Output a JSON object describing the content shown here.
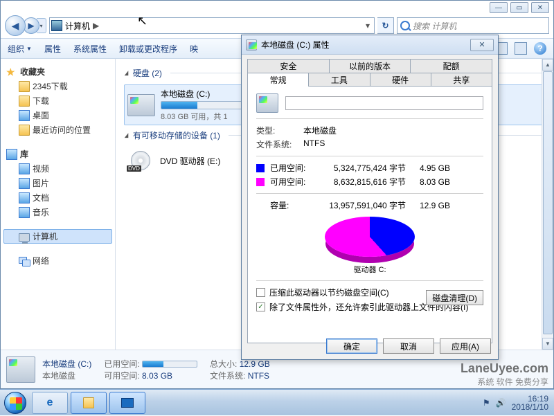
{
  "window": {
    "address_path": "计算机",
    "address_sep": "▶",
    "search_placeholder": "搜索 计算机"
  },
  "toolbar": {
    "organize": "组织",
    "properties": "属性",
    "sysprops": "系统属性",
    "uninstall": "卸载或更改程序",
    "map": "映"
  },
  "sidebar": {
    "favorites": "收藏夹",
    "fav_items": [
      "2345下载",
      "下载",
      "桌面",
      "最近访问的位置"
    ],
    "libraries": "库",
    "lib_items": [
      "视频",
      "图片",
      "文档",
      "音乐"
    ],
    "computer": "计算机",
    "network": "网络"
  },
  "content": {
    "section_hdd": "硬盘 (2)",
    "section_removable": "有可移动存储的设备 (1)",
    "drive_c_name": "本地磁盘 (C:)",
    "drive_c_sub": "8.03 GB 可用，共 1",
    "dvd_name": "DVD 驱动器 (E:)"
  },
  "details": {
    "name": "本地磁盘 (C:)",
    "type": "本地磁盘",
    "used_label": "已用空间:",
    "free_label": "可用空间:",
    "free_value": "8.03 GB",
    "total_label": "总大小:",
    "total_value": "12.9 GB",
    "fs_label": "文件系统:",
    "fs_value": "NTFS"
  },
  "dialog": {
    "title": "本地磁盘 (C:) 属性",
    "tabs_top": [
      "安全",
      "以前的版本",
      "配额"
    ],
    "tabs_bottom": [
      "常规",
      "工具",
      "硬件",
      "共享"
    ],
    "type_label": "类型:",
    "type_value": "本地磁盘",
    "fs_label": "文件系统:",
    "fs_value": "NTFS",
    "used_label": "已用空间:",
    "used_bytes": "5,324,775,424 字节",
    "used_gb": "4.95 GB",
    "free_label": "可用空间:",
    "free_bytes": "8,632,815,616 字节",
    "free_gb": "8.03 GB",
    "cap_label": "容量:",
    "cap_bytes": "13,957,591,040 字节",
    "cap_gb": "12.9 GB",
    "drive_label": "驱动器 C:",
    "cleanup": "磁盘清理(D)",
    "compress": "压缩此驱动器以节约磁盘空间(C)",
    "index": "除了文件属性外，还允许索引此驱动器上文件的内容(I)",
    "ok": "确定",
    "cancel": "取消",
    "apply": "应用(A)"
  },
  "taskbar": {
    "time": "16:19",
    "date": "2018/1/10"
  },
  "watermark": {
    "line1": "LaneUyee.com",
    "line2": "系统 软件 免费分享"
  },
  "chart_data": {
    "type": "pie",
    "title": "驱动器 C:",
    "series": [
      {
        "name": "已用空间",
        "value": 4.95,
        "bytes": 5324775424,
        "color": "#0000ff"
      },
      {
        "name": "可用空间",
        "value": 8.03,
        "bytes": 8632815616,
        "color": "#ff00ff"
      }
    ],
    "total": 12.9,
    "unit": "GB"
  }
}
